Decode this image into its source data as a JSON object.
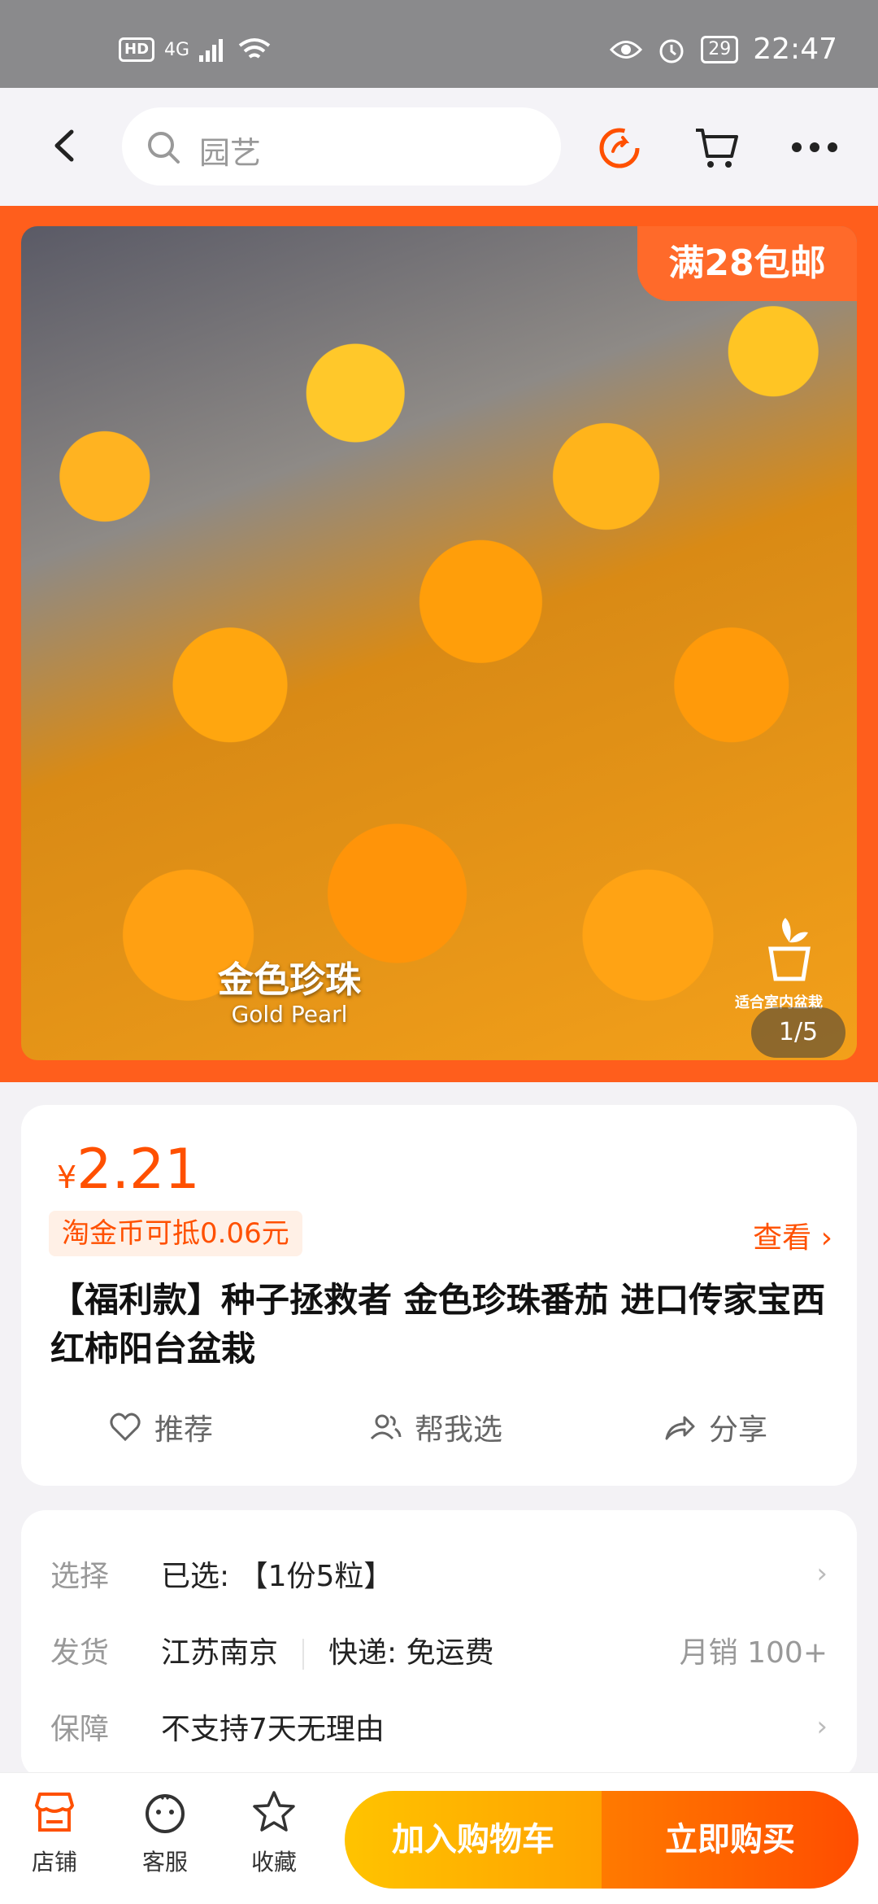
{
  "status_bar": {
    "network": "4G",
    "hd": "HD",
    "battery": "29",
    "time": "22:47"
  },
  "search": {
    "placeholder": "园艺"
  },
  "hero": {
    "promo": "满28包邮",
    "product_name_cn": "金色珍珠",
    "product_name_en": "Gold Pearl",
    "pot_label": "适合室内盆栽",
    "pager": "1/5"
  },
  "price": {
    "currency": "¥",
    "value": "2.21",
    "coin_offer": "淘金币可抵0.06元",
    "view_label": "查看"
  },
  "product": {
    "title": "【福利款】种子拯救者 金色珍珠番茄 进口传家宝西红柿阳台盆栽"
  },
  "actions": {
    "recommend": "推荐",
    "help_choose": "帮我选",
    "share": "分享"
  },
  "details": {
    "select_label": "选择",
    "select_value": "已选: 【1份5粒】",
    "ship_label": "发货",
    "ship_from": "江苏南京",
    "ship_method": "快递: 免运费",
    "monthly_sales": "月销  100+",
    "guarantee_label": "保障",
    "guarantee_value": "不支持7天无理由"
  },
  "bottom_bar": {
    "shop": "店铺",
    "service": "客服",
    "favorite": "收藏",
    "add_to_cart": "加入购物车",
    "buy_now": "立即购买"
  },
  "colors": {
    "accent": "#ff5000",
    "hero_bg": "#ff5e1c",
    "cart_button": "#ffb300",
    "buy_button": "#ff5a00"
  }
}
